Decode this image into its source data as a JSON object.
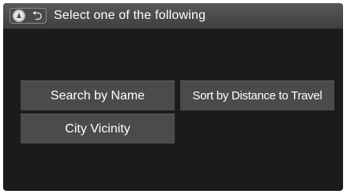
{
  "header": {
    "title": "Select one of the following",
    "icons": [
      "navigation-icon",
      "back-icon"
    ],
    "back_glyph": "⮌"
  },
  "options": {
    "search_by_name": "Search by Name",
    "sort_by_distance": "Sort by Distance to Travel",
    "city_vicinity": "City Vicinity"
  },
  "colors": {
    "background": "#1b1b1b",
    "header": "#4a4a4a",
    "button": "#4b4b4b",
    "text": "#ffffff"
  }
}
